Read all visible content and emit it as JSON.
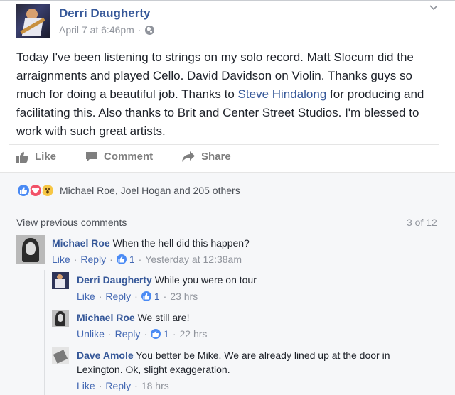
{
  "post": {
    "author": "Derri Daugherty",
    "timestamp": "April 7 at 6:46pm",
    "privacy_icon": "globe-icon",
    "text_before_link": "Today I've been listening to strings on my solo record. Matt Slocum did the arraignments and played Cello. David Davidson on Violin. Thanks guys so much for doing a beautiful job. Thanks to ",
    "link_text": "Steve Hindalong",
    "text_after_link": " for producing and facilitating this. Also thanks to Brit and Center Street Studios. I'm blessed to work with such great artists."
  },
  "actions": {
    "like": "Like",
    "comment": "Comment",
    "share": "Share"
  },
  "reactions": {
    "types": [
      "like",
      "love",
      "wow"
    ],
    "summary": "Michael Roe, Joel Hogan and 205 others"
  },
  "comments_header": {
    "view_previous": "View previous comments",
    "count": "3 of 12"
  },
  "comments": [
    {
      "name": "Michael Roe",
      "text": "When the hell did this happen?",
      "like_label": "Like",
      "reply_label": "Reply",
      "likes": "1",
      "time": "Yesterday at 12:38am"
    },
    {
      "name": "Derri Daugherty",
      "text": "While you were on tour",
      "like_label": "Like",
      "reply_label": "Reply",
      "likes": "1",
      "time": "23 hrs"
    },
    {
      "name": "Michael Roe",
      "text": "We still are!",
      "like_label": "Unlike",
      "reply_label": "Reply",
      "likes": "1",
      "time": "22 hrs"
    },
    {
      "name": "Dave Amole",
      "text_line1": "You better be Mike. We are already lined up at the door in",
      "text_line2": "Lexington. Ok, slight exaggeration.",
      "like_label": "Like",
      "reply_label": "Reply",
      "time": "18 hrs"
    }
  ],
  "colors": {
    "link": "#365899",
    "action_link": "#4267b2",
    "meta": "#90949c",
    "panel_bg": "#f6f7f9"
  }
}
